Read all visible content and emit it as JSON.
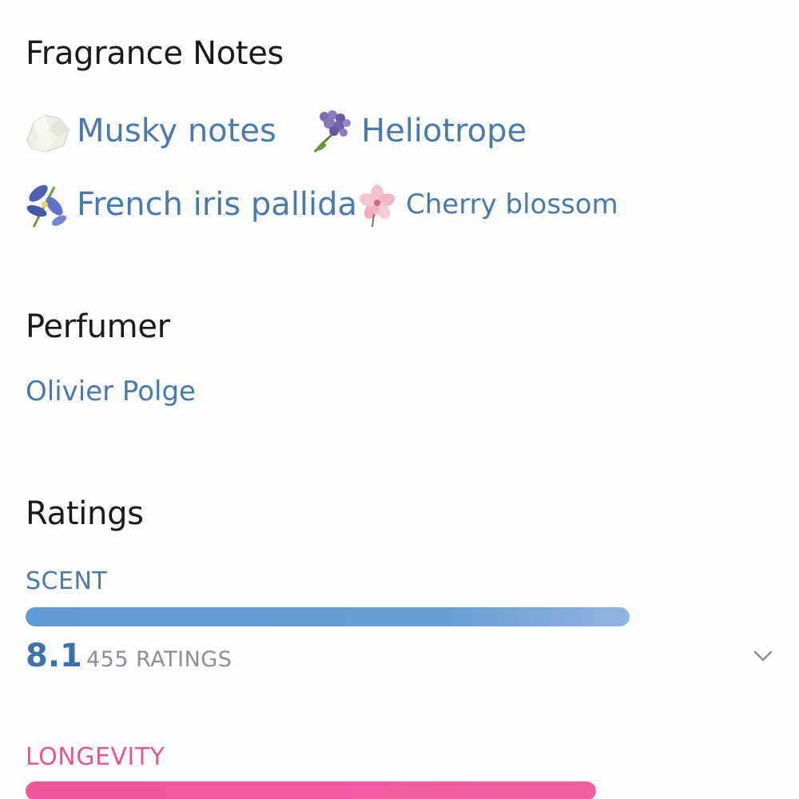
{
  "fragrance_notes": {
    "title": "Fragrance Notes",
    "notes": [
      {
        "label": "Musky notes",
        "icon": "musk-crystal-icon"
      },
      {
        "label": "Heliotrope",
        "icon": "heliotrope-flower-icon"
      },
      {
        "label": "French iris pallida",
        "icon": "iris-flower-icon"
      },
      {
        "label": "Cherry blossom",
        "icon": "cherry-blossom-icon"
      }
    ]
  },
  "perfumer": {
    "title": "Perfumer",
    "name": "Olivier Polge"
  },
  "ratings": {
    "title": "Ratings",
    "items": [
      {
        "label": "SCENT",
        "score": "8.1",
        "count": "455 RATINGS",
        "fill_fraction": 0.81,
        "color": "#5e9ad4"
      },
      {
        "label": "LONGEVITY",
        "fill_fraction": 0.79,
        "color": "#f2559a"
      }
    ]
  },
  "colors": {
    "link": "#4a7aab",
    "scent": "#5e9ad4",
    "longevity": "#e9578f",
    "muted": "#8c9096"
  }
}
